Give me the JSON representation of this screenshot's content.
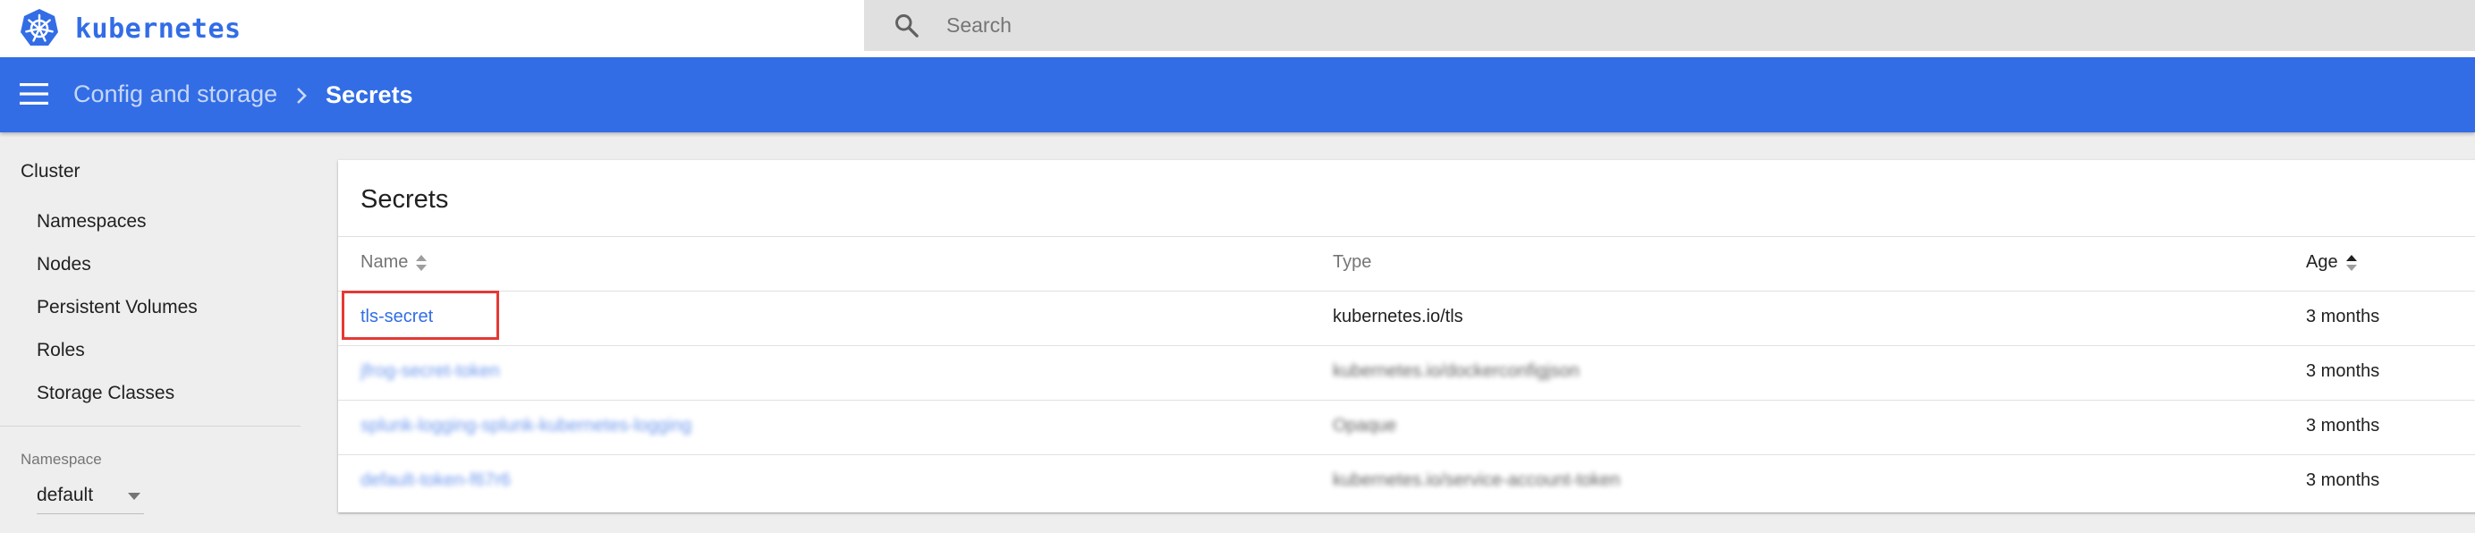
{
  "app": {
    "name": "kubernetes",
    "brand_color": "#326de6"
  },
  "search": {
    "placeholder": "Search",
    "icon": "search-icon"
  },
  "header": {
    "menu_icon": "menu-icon",
    "breadcrumb": [
      {
        "label": "Config and storage"
      },
      {
        "label": "Secrets"
      }
    ],
    "separator_icon": "chevron-right-icon"
  },
  "sidebar": {
    "cluster_heading": "Cluster",
    "items": [
      {
        "label": "Namespaces"
      },
      {
        "label": "Nodes"
      },
      {
        "label": "Persistent Volumes"
      },
      {
        "label": "Roles"
      },
      {
        "label": "Storage Classes"
      }
    ],
    "namespace_label": "Namespace",
    "namespace_value": "default"
  },
  "secrets": {
    "title": "Secrets",
    "columns": [
      {
        "label": "Name",
        "sort": "unsorted"
      },
      {
        "label": "Type",
        "sort": "none"
      },
      {
        "label": "Age",
        "sort": "ascending"
      }
    ],
    "rows": [
      {
        "name": "tls-secret",
        "type": "kubernetes.io/tls",
        "age": "3 months",
        "blurred": false,
        "highlighted": true
      },
      {
        "name": "jfrog-secret-token",
        "type": "kubernetes.io/dockerconfigjson",
        "age": "3 months",
        "blurred": true,
        "highlighted": false
      },
      {
        "name": "splunk-logging-splunk-kubernetes-logging",
        "type": "Opaque",
        "age": "3 months",
        "blurred": true,
        "highlighted": false
      },
      {
        "name": "default-token-f67r6",
        "type": "kubernetes.io/service-account-token",
        "age": "3 months",
        "blurred": true,
        "highlighted": false
      }
    ]
  },
  "colors": {
    "header_bg": "#326de6",
    "link": "#326de6",
    "highlight_box": "#e53935",
    "page_bg": "#eeeeee"
  }
}
